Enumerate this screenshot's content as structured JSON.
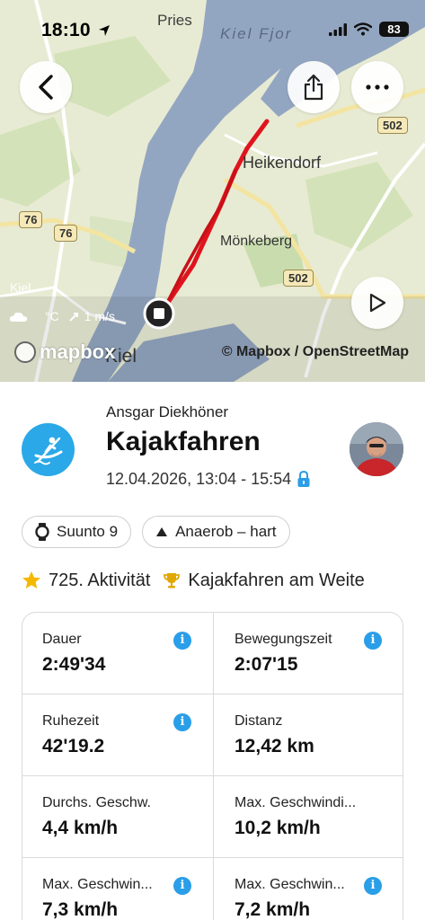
{
  "status_bar": {
    "time": "18:10",
    "battery": "83"
  },
  "map": {
    "labels": {
      "pries": "Pries",
      "kiel_fjord": "Kiel Fjor",
      "heikendorf": "Heikendorf",
      "moenkeberg": "Mönkeberg",
      "kiel_small": "Kiel",
      "kiel_city": "Kiel"
    },
    "roads": {
      "r502_top": "502",
      "r502_bottom": "502",
      "r76_a": "76",
      "r76_b": "76"
    },
    "weather": {
      "temp": "°C",
      "wind": "1 m/s"
    },
    "mapbox_logo": "mapbox",
    "attribution": "© Mapbox / OpenStreetMap"
  },
  "activity": {
    "user_name": "Ansgar Diekhöner",
    "title": "Kajakfahren",
    "date": "12.04.2026, 13:04 - 15:54"
  },
  "chips": {
    "device": "Suunto 9",
    "training": "Anaerob – hart"
  },
  "achievements": {
    "count": "725. Aktivität",
    "record": "Kajakfahren am Weite"
  },
  "stats": [
    {
      "label": "Dauer",
      "value": "2:49'34",
      "info": true
    },
    {
      "label": "Bewegungszeit",
      "value": "2:07'15",
      "info": true
    },
    {
      "label": "Ruhezeit",
      "value": "42'19.2",
      "info": true
    },
    {
      "label": "Distanz",
      "value": "12,42 km",
      "info": false
    },
    {
      "label": "Durchs. Geschw.",
      "value": "4,4 km/h",
      "info": false
    },
    {
      "label": "Max. Geschwindi...",
      "value": "10,2 km/h",
      "info": false
    },
    {
      "label": "Max. Geschwin...",
      "value": "7,3 km/h",
      "info": true
    },
    {
      "label": "Max. Geschwin...",
      "value": "7,2 km/h",
      "info": true
    }
  ],
  "colors": {
    "accent_blue": "#2a9ee8",
    "activity_icon_bg": "#2aa8e8",
    "route": "#e0141e",
    "water": "#8fa3bf",
    "land": "#e9ecd6"
  }
}
